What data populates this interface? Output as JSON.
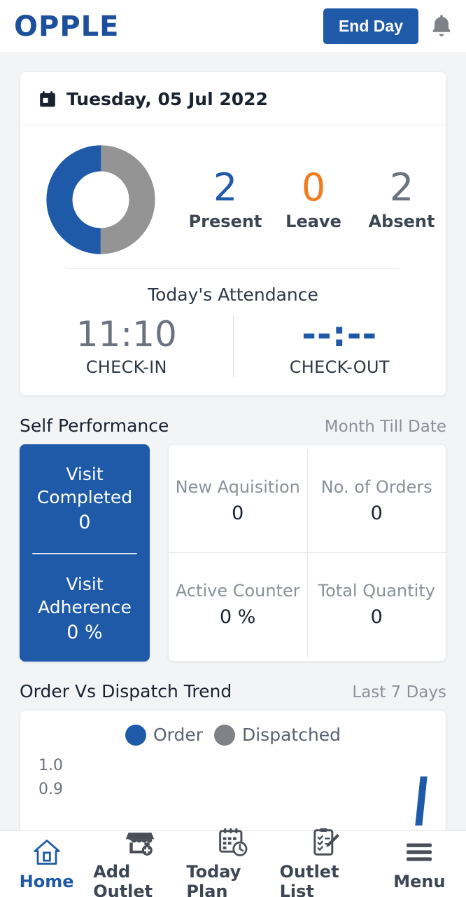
{
  "header": {
    "logo_text": "OPPLE",
    "end_day_label": "End Day",
    "bell_icon": "bell-icon"
  },
  "attendance": {
    "date": "Tuesday, 05 Jul 2022",
    "calendar_icon": "calendar-icon",
    "donut": {
      "present_pct": 50,
      "absent_pct": 50,
      "present_color": "#1f5aa8",
      "absent_color": "#949494"
    },
    "stats": [
      {
        "value": "2",
        "label": "Present",
        "color": "#1f5aa8"
      },
      {
        "value": "0",
        "label": "Leave",
        "color": "#f07c1f"
      },
      {
        "value": "2",
        "label": "Absent",
        "color": "#6b7280"
      }
    ],
    "today_title": "Today's Attendance",
    "check_in": {
      "time": "11:10",
      "label": "CHECK-IN"
    },
    "check_out": {
      "time": "--:--",
      "label": "CHECK-OUT"
    }
  },
  "self_performance": {
    "title": "Self Performance",
    "period": "Month Till Date",
    "visit": {
      "completed_label": "Visit\nCompleted",
      "completed_label_line1": "Visit",
      "completed_label_line2": "Completed",
      "completed_value": "0",
      "adherence_label_line1": "Visit",
      "adherence_label_line2": "Adherence",
      "adherence_value": "0 %"
    },
    "metrics": [
      {
        "label": "New Aquisition",
        "value": "0"
      },
      {
        "label": "No. of Orders",
        "value": "0"
      },
      {
        "label": "Active Counter",
        "value": "0 %"
      },
      {
        "label": "Total Quantity",
        "value": "0"
      }
    ]
  },
  "trend": {
    "title": "Order Vs Dispatch Trend",
    "period": "Last 7 Days"
  },
  "chart_data": {
    "type": "bar",
    "title": "Order Vs Dispatch Trend",
    "subtitle": "Last 7 Days",
    "legend": [
      {
        "name": "Order",
        "color": "#1f5aa8"
      },
      {
        "name": "Dispatched",
        "color": "#7f8287"
      }
    ],
    "legend_position": "top-right",
    "y_ticks": [
      "1.0",
      "0.9"
    ],
    "ylim": [
      0,
      1.0
    ],
    "categories": [],
    "series": [
      {
        "name": "Order",
        "values": []
      },
      {
        "name": "Dispatched",
        "values": []
      }
    ],
    "grid": false,
    "note": "chart clipped by viewport; only top of plot visible"
  },
  "bottom_nav": [
    {
      "label": "Home",
      "icon": "home-icon",
      "active": true
    },
    {
      "label": "Add Outlet",
      "icon": "storefront-plus-icon",
      "active": false
    },
    {
      "label": "Today Plan",
      "icon": "calendar-clock-icon",
      "active": false
    },
    {
      "label": "Outlet List",
      "icon": "clipboard-pencil-icon",
      "active": false
    },
    {
      "label": "Menu",
      "icon": "hamburger-icon",
      "active": false
    }
  ]
}
